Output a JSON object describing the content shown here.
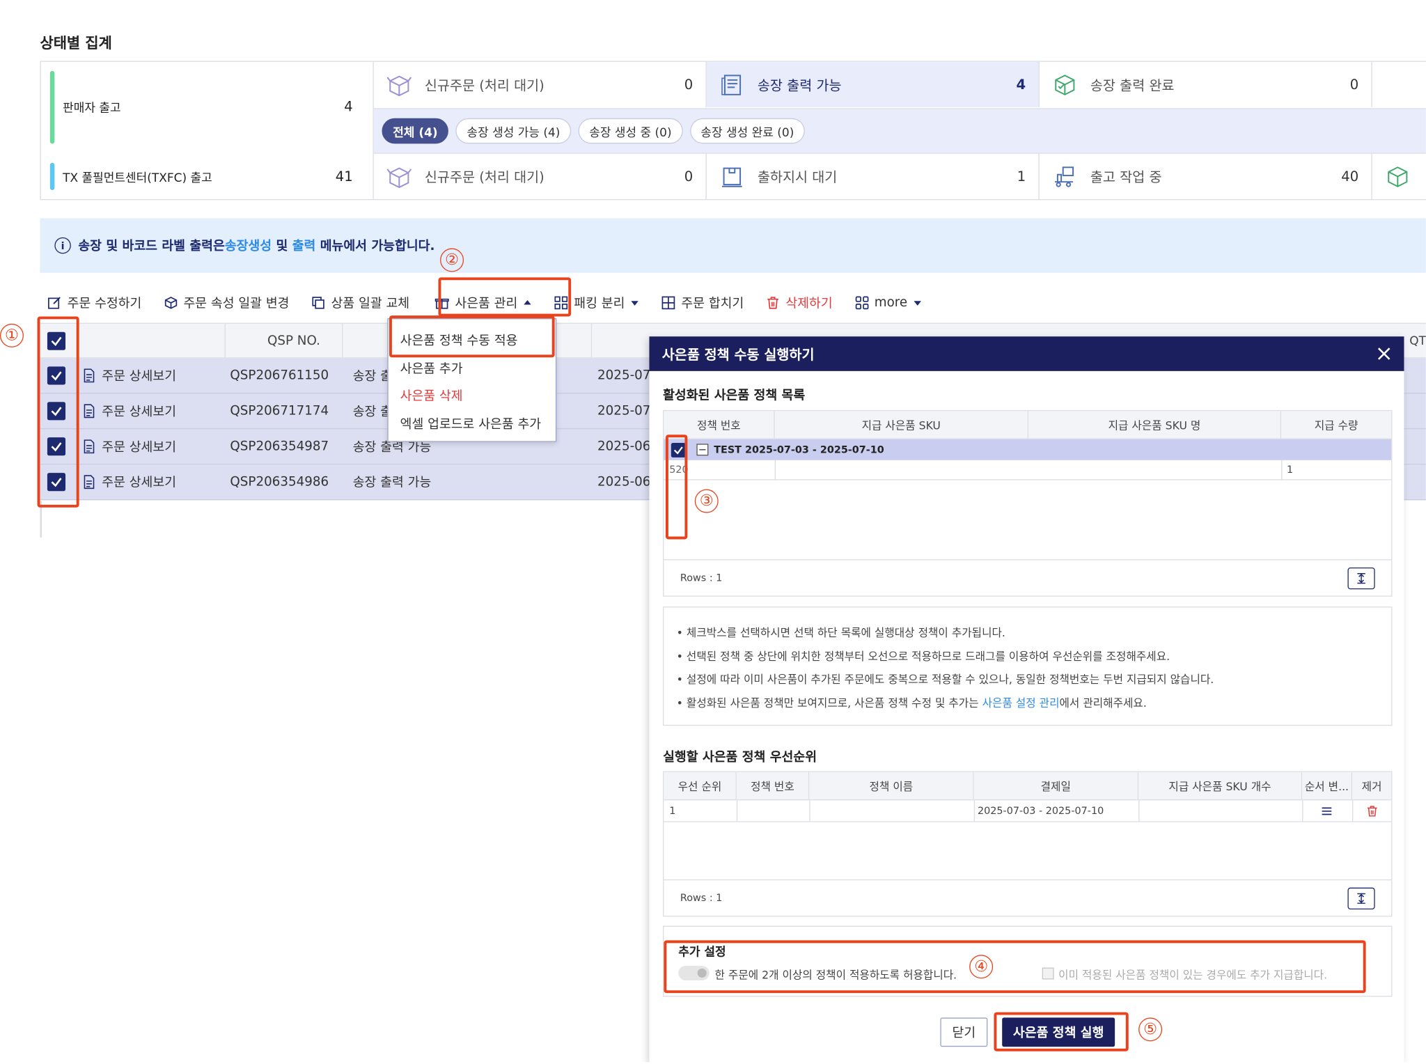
{
  "page": {
    "title": "상태별 집계"
  },
  "summary": {
    "seller": {
      "label": "판매자 출고",
      "count": "4"
    },
    "fulfillment": {
      "label": "TX 풀필먼트센터(TXFC) 출고",
      "count": "41"
    },
    "seller_cells": [
      {
        "label": "신규주문 (처리 대기)",
        "count": "0",
        "icon": "box-open-icon"
      },
      {
        "label": "송장 출력 가능",
        "count": "4",
        "icon": "invoice-icon"
      },
      {
        "label": "송장 출력 완료",
        "count": "0",
        "icon": "box-check-icon"
      }
    ],
    "fulfillment_cells": [
      {
        "label": "신규주문 (처리 대기)",
        "count": "0",
        "icon": "box-open-icon"
      },
      {
        "label": "출하지시 대기",
        "count": "1",
        "icon": "clipboard-icon"
      },
      {
        "label": "출고 작업 중",
        "count": "40",
        "icon": "forklift-icon"
      }
    ],
    "chips": [
      "전체 (4)",
      "송장 생성 가능 (4)",
      "송장 생성 중 (0)",
      "송장 생성 완료 (0)"
    ]
  },
  "info": {
    "prefix": "송장 및 바코드 라벨 출력은 ",
    "link1": "송장생성",
    "mid": " 및 ",
    "link2": "출력",
    "suffix": " 메뉴에서 가능합니다."
  },
  "toolbar": {
    "edit": "주문 수정하기",
    "bulk_attr": "주문 속성 일괄 변경",
    "bulk_product": "상품 일괄 교체",
    "gift": "사은품 관리",
    "packing": "패킹 분리",
    "merge": "주문 합치기",
    "delete": "삭제하기",
    "more": "more"
  },
  "dropdown": {
    "items": [
      "사은품 정책 수동 적용",
      "사은품 추가",
      "사은품 삭제",
      "엑셀 업로드로 사은품 추가"
    ]
  },
  "grid": {
    "col_qsp": "QSP NO.",
    "col_hidden_end": "QT",
    "rows": [
      {
        "link": "주문 상세보기",
        "qsp": "QSP206761150",
        "status": "송장 출",
        "date": "2025-07-"
      },
      {
        "link": "주문 상세보기",
        "qsp": "QSP206717174",
        "status": "송장 출",
        "date": "2025-07-"
      },
      {
        "link": "주문 상세보기",
        "qsp": "QSP206354987",
        "status": "송장 출력 가능",
        "date": "2025-06-"
      },
      {
        "link": "주문 상세보기",
        "qsp": "QSP206354986",
        "status": "송장 출력 가능",
        "date": "2025-06-"
      }
    ]
  },
  "modal": {
    "title": "사은품 정책 수동 실행하기",
    "active_title": "활성화된 사은품 정책 목록",
    "active_cols": [
      "정책 번호",
      "지급 사은품 SKU",
      "지급 사은품 SKU 명",
      "지급 수량"
    ],
    "group_label": "TEST 2025-07-03 - 2025-07-10",
    "policy_no_fragment": "520",
    "qty": "1",
    "rows_label": "Rows : 1",
    "notes": [
      "체크박스를 선택하시면 선택 하단 목록에 실행대상 정책이 추가됩니다.",
      "선택된 정책 중 상단에 위치한 정책부터 오선으로 적용하므로 드래그를 이용하여 우선순위를 조정해주세요.",
      "설정에 따라 이미 사은품이 추가된 주문에도 중복으로 적용할 수 있으나, 동일한 정책번호는 두번 지급되지 않습니다."
    ],
    "note4_prefix": "활성화된 사은품 정책만 보여지므로, 사은품 정책 수정 및 추가는 ",
    "note4_link": "사은품 설정 관리",
    "note4_suffix": "에서 관리해주세요.",
    "priority_title": "실행할 사은품 정책 우선순위",
    "priority_cols": [
      "우선 순위",
      "정책 번호",
      "정책 이름",
      "결제일",
      "지급 사은품 SKU 개수",
      "순서 변...",
      "제거"
    ],
    "priority_row": {
      "rank": "1",
      "date": "2025-07-03 - 2025-07-10"
    },
    "settings_title": "추가 설정",
    "opt_multi": "한 주문에 2개 이상의 정책이 적용하도록 허용합니다.",
    "opt_extra": "이미 적용된 사은품 정책이 있는 경우에도 추가 지급합니다.",
    "btn_close": "닫기",
    "btn_run": "사은품 정책 실행"
  },
  "annotations": [
    "①",
    "②",
    "③",
    "④",
    "⑤"
  ]
}
